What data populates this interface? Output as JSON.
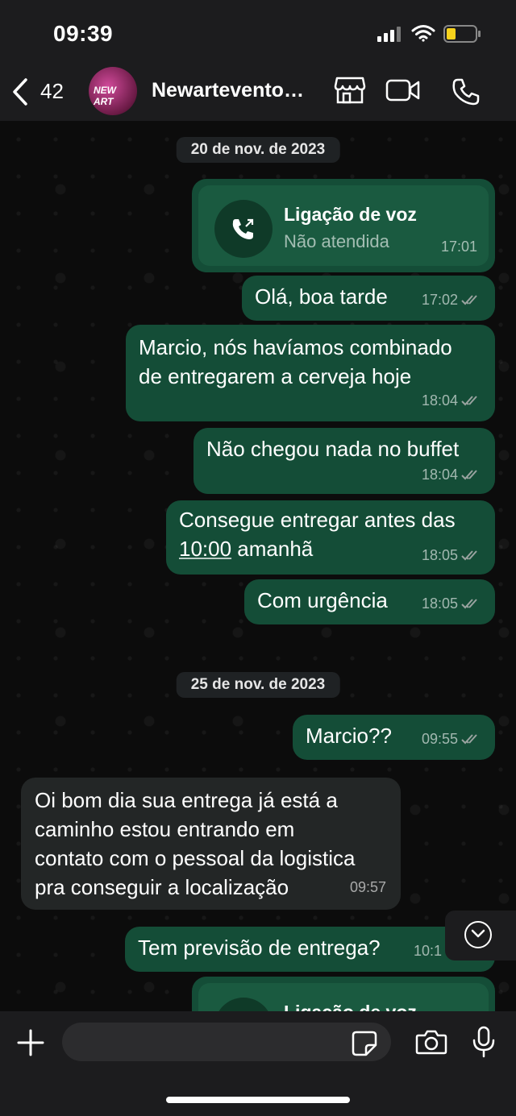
{
  "status_bar": {
    "time": "09:39"
  },
  "header": {
    "back_count": "42",
    "title": "Newartevento…",
    "avatar_text": "NEW ART"
  },
  "messages": [
    {
      "kind": "date",
      "text": "20 de nov. de 2023"
    },
    {
      "kind": "call",
      "title": "Ligação de voz",
      "subtitle": "Não atendida",
      "time": "17:01"
    },
    {
      "kind": "out",
      "lines": [
        "Olá, boa tarde"
      ],
      "time": "17:02"
    },
    {
      "kind": "out",
      "lines": [
        "Marcio, nós havíamos combinado",
        "de entregarem a cerveja hoje"
      ],
      "time": "18:04"
    },
    {
      "kind": "out",
      "lines": [
        "Não chegou nada no buffet"
      ],
      "time": "18:04"
    },
    {
      "kind": "out",
      "lines": [
        "Consegue entregar antes das"
      ],
      "link": "10:00",
      "after_link": " amanhã",
      "time": "18:05"
    },
    {
      "kind": "out",
      "lines": [
        "Com urgência"
      ],
      "time": "18:05"
    },
    {
      "kind": "date",
      "text": "25 de nov. de 2023"
    },
    {
      "kind": "out",
      "lines": [
        "Marcio??"
      ],
      "time": "09:55"
    },
    {
      "kind": "in",
      "lines": [
        "Oi bom dia sua entrega já está a",
        "caminho estou entrando em",
        "contato com o pessoal da logistica",
        "pra conseguir a localização"
      ],
      "time": "09:57"
    },
    {
      "kind": "out",
      "lines": [
        "Tem previsão de entrega?"
      ],
      "time": "10:1"
    },
    {
      "kind": "call",
      "title": "Ligação de voz",
      "subtitle": "",
      "time": ""
    }
  ],
  "composer": {
    "placeholder": ""
  },
  "colors": {
    "outgoing": "#144d37",
    "incoming": "#232626",
    "background": "#0c0c0c",
    "bar": "#1c1c1e"
  }
}
